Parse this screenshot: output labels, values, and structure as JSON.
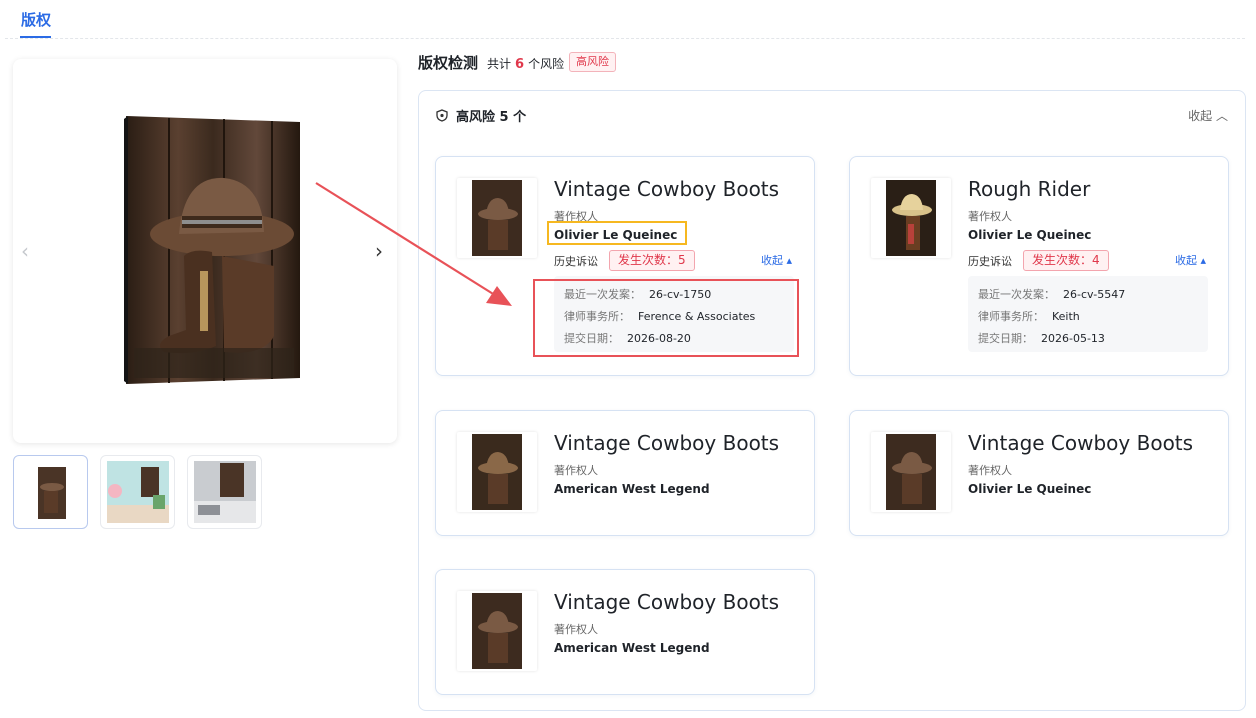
{
  "top_tab": {
    "label": "版权"
  },
  "preview": {
    "prev_glyph": "‹",
    "next_glyph": "›",
    "thumbnails": [
      {
        "name": "thumbnail-product"
      },
      {
        "name": "thumbnail-living-room"
      },
      {
        "name": "thumbnail-bedroom"
      }
    ]
  },
  "detection": {
    "title": "版权检测",
    "summary_prefix": "共计",
    "summary_count": "6",
    "summary_suffix": "个风险",
    "risk_tag": "高风险",
    "group_label": "高风险 5 个",
    "group_collapse": "收起",
    "cards": [
      {
        "title": "Vintage Cowboy Boots",
        "owner_label": "著作权人",
        "owner": "Olivier Le Queinec",
        "history_label": "历史诉讼",
        "history_tag": "发生次数：5",
        "collapse": "收起",
        "details": [
          {
            "k": "最近一次发案：",
            "v": "26-cv-1750"
          },
          {
            "k": "律师事务所：",
            "v": "Ference & Associates"
          },
          {
            "k": "提交日期：",
            "v": "2026-08-20"
          }
        ]
      },
      {
        "title": "Rough Rider",
        "owner_label": "著作权人",
        "owner": "Olivier Le Queinec",
        "history_label": "历史诉讼",
        "history_tag": "发生次数：4",
        "collapse": "收起",
        "details": [
          {
            "k": "最近一次发案：",
            "v": "26-cv-5547"
          },
          {
            "k": "律师事务所：",
            "v": "Keith"
          },
          {
            "k": "提交日期：",
            "v": "2026-05-13"
          }
        ]
      },
      {
        "title": "Vintage Cowboy Boots",
        "owner_label": "著作权人",
        "owner": "American West Legend"
      },
      {
        "title": "Vintage Cowboy Boots",
        "owner_label": "著作权人",
        "owner": "Olivier Le Queinec"
      },
      {
        "title": "Vintage Cowboy Boots",
        "owner_label": "著作权人",
        "owner": "American West Legend"
      }
    ]
  },
  "colors": {
    "accent": "#2b6be5",
    "danger": "#e0384b",
    "highlight_yellow": "#f6b820",
    "highlight_red": "#e85258"
  }
}
